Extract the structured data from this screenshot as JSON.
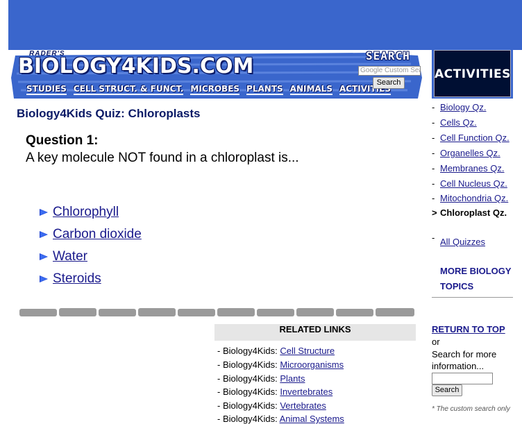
{
  "header": {
    "logo_prefix": "RADER'S",
    "logo": "BIOLOGY4KIDS.COM",
    "nav": [
      "STUDIES",
      "CELL STRUCT. & FUNCT.",
      "MICROBES",
      "PLANTS",
      "ANIMALS",
      "ACTIVITIES"
    ],
    "search_title": "SEARCH",
    "search_placeholder": "Google Custom Search",
    "search_button": "Search"
  },
  "activities_label": "ACTIVITIES",
  "page_title": "Biology4Kids Quiz: Chloroplasts",
  "question": {
    "heading": "Question 1:",
    "text": "A key molecule NOT found in a chloroplast is...",
    "answers": [
      "Chlorophyll",
      "Carbon dioxide",
      "Water",
      "Steroids"
    ]
  },
  "related": {
    "header": "RELATED LINKS",
    "prefix": "- Biology4Kids: ",
    "items": [
      "Cell Structure",
      "Microorganisms",
      "Plants",
      "Invertebrates",
      "Vertebrates",
      "Animal Systems"
    ]
  },
  "sidebar": {
    "items": [
      {
        "marker": "-",
        "label": "Biology Qz."
      },
      {
        "marker": "-",
        "label": "Cells Qz."
      },
      {
        "marker": "-",
        "label": "Cell Function Qz."
      },
      {
        "marker": "-",
        "label": "Organelles Qz."
      },
      {
        "marker": "-",
        "label": "Membranes Qz."
      },
      {
        "marker": "-",
        "label": "Cell Nucleus Qz."
      },
      {
        "marker": "-",
        "label": "Mitochondria Qz."
      },
      {
        "marker": ">",
        "label": "Chloroplast Qz."
      }
    ],
    "all_quizzes_marker": "-",
    "all_quizzes": "All Quizzes",
    "more_topics": "MORE BIOLOGY TOPICS",
    "return_top": "RETURN TO TOP",
    "or": "or",
    "search_more": "Search for more information...",
    "search_button": "Search",
    "note": "* The custom search only"
  },
  "colors": {
    "brand_blue": "#3a66cc",
    "link": "#1a1a8c",
    "title": "#0a1a66"
  }
}
